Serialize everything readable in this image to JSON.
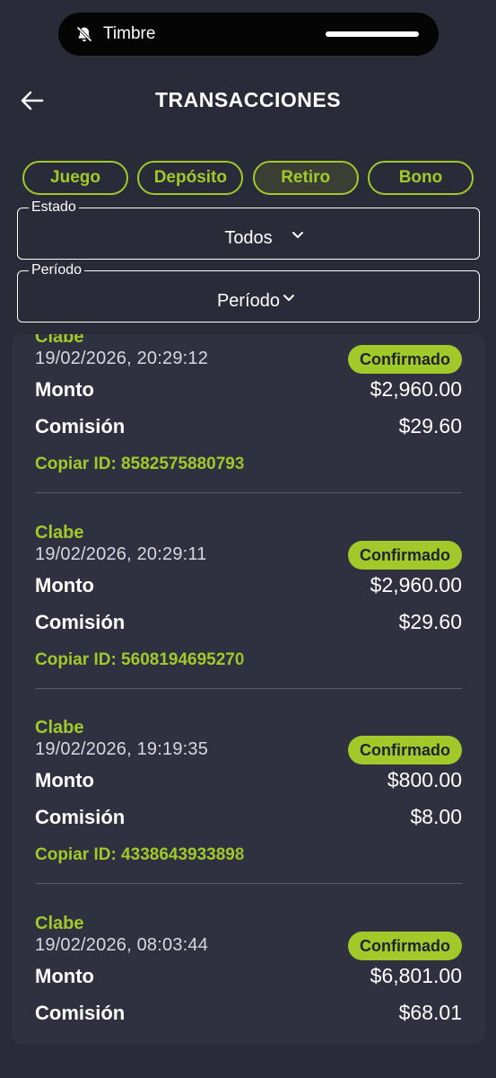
{
  "notification": {
    "text": "Timbre"
  },
  "header": {
    "title": "TRANSACCIONES"
  },
  "chips": [
    {
      "label": "Juego",
      "active": false
    },
    {
      "label": "Depósito",
      "active": false
    },
    {
      "label": "Retiro",
      "active": true
    },
    {
      "label": "Bono",
      "active": false
    }
  ],
  "filters": {
    "estado": {
      "legend": "Estado",
      "value": "Todos"
    },
    "periodo": {
      "legend": "Período",
      "value": "Período"
    }
  },
  "labels": {
    "monto": "Monto",
    "comision": "Comisión"
  },
  "colors": {
    "accent": "#a1c92a",
    "background": "#292b39",
    "panel": "#2f3140"
  },
  "transactions": [
    {
      "method": "Clabe",
      "date": "19/02/2026, 20:29:12",
      "status": "Confirmado",
      "monto": "$2,960.00",
      "comision": "$29.60",
      "copy": "Copiar ID: 8582575880793"
    },
    {
      "method": "Clabe",
      "date": "19/02/2026, 20:29:11",
      "status": "Confirmado",
      "monto": "$2,960.00",
      "comision": "$29.60",
      "copy": "Copiar ID: 5608194695270"
    },
    {
      "method": "Clabe",
      "date": "19/02/2026, 19:19:35",
      "status": "Confirmado",
      "monto": "$800.00",
      "comision": "$8.00",
      "copy": "Copiar ID: 4338643933898"
    },
    {
      "method": "Clabe",
      "date": "19/02/2026, 08:03:44",
      "status": "Confirmado",
      "monto": "$6,801.00",
      "comision": "$68.01",
      "copy": ""
    }
  ]
}
